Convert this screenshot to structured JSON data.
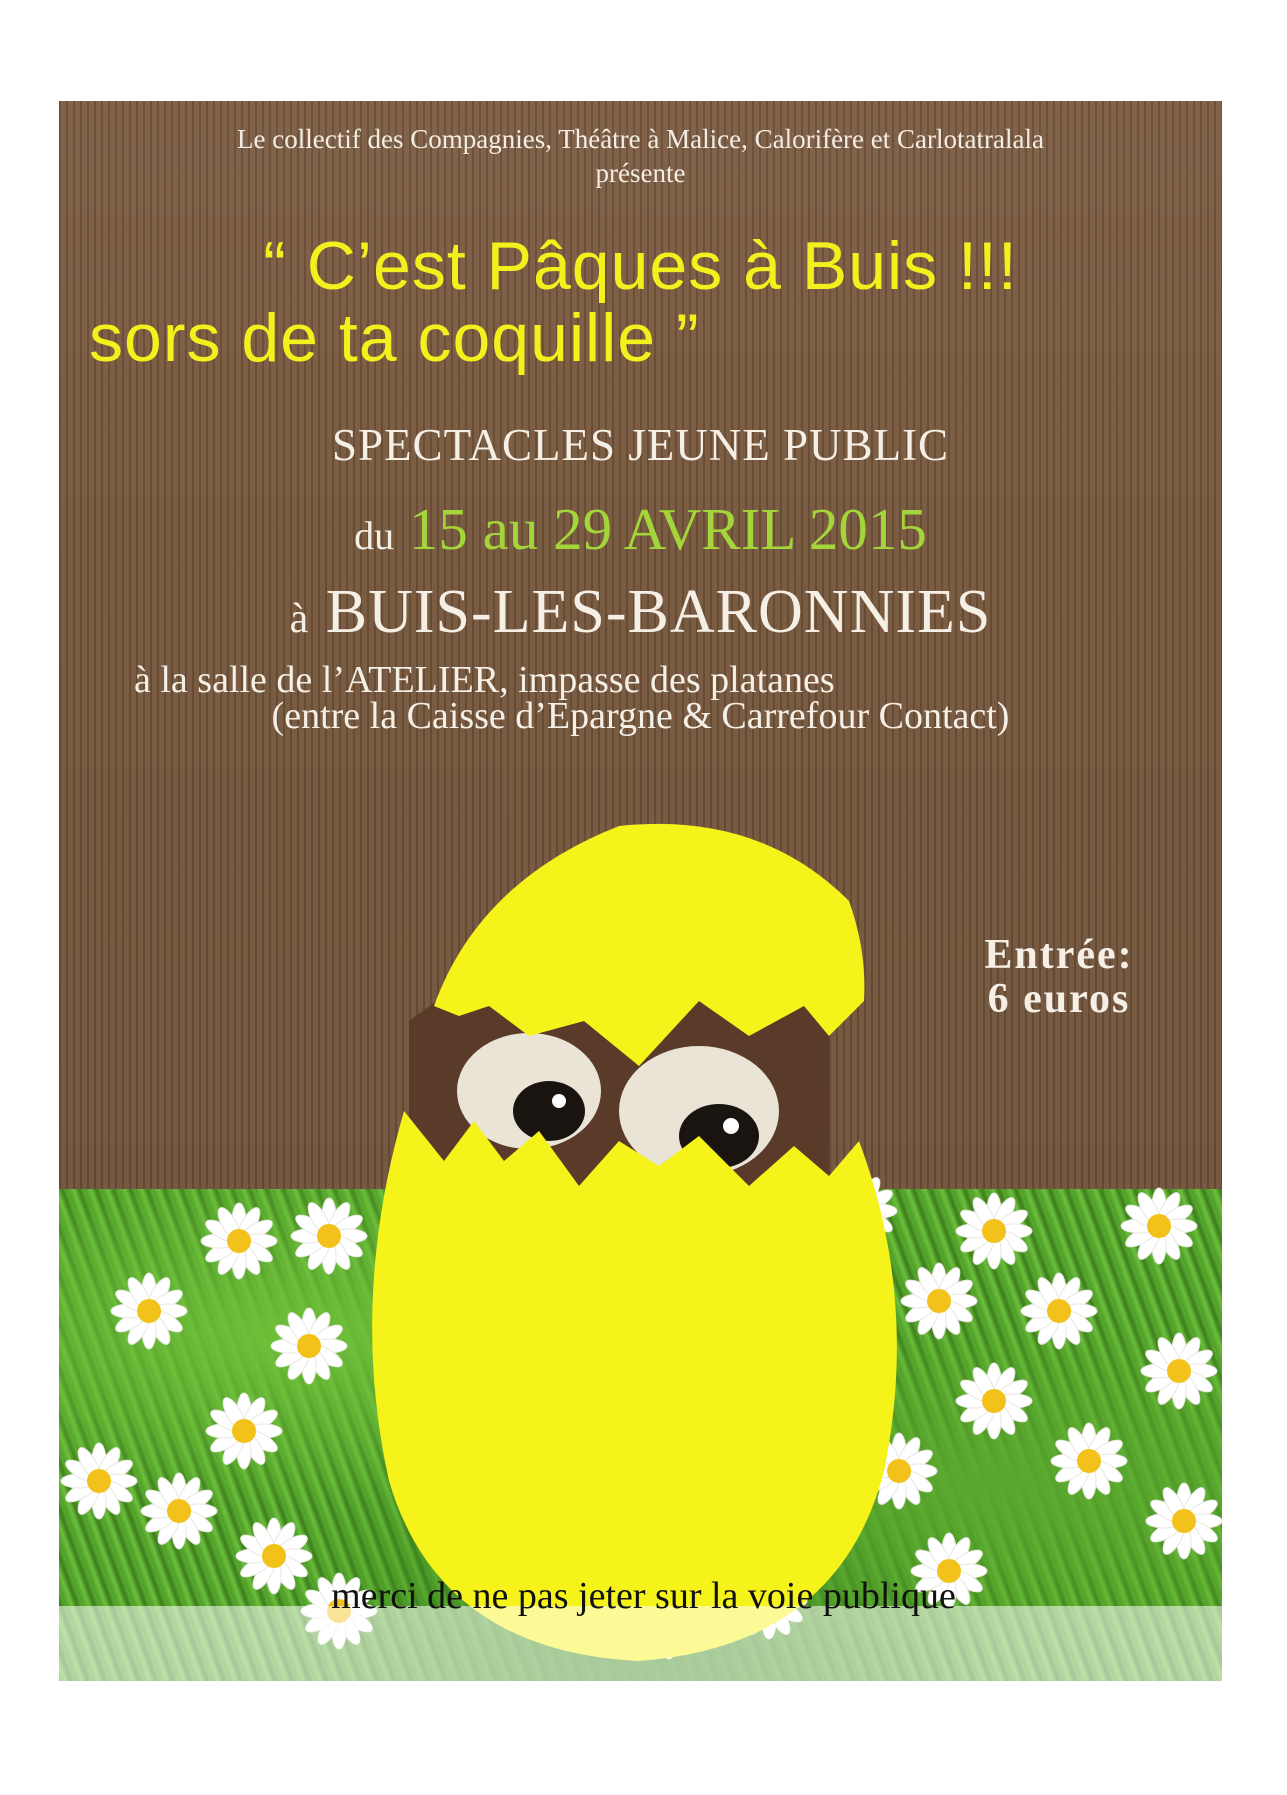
{
  "poster": {
    "presenter_line": "Le collectif des Compagnies, Théâtre à Malice, Calorifère et Carlotatralala",
    "presente": "présente",
    "title_line1": "“ C’est Pâques à Buis !!!",
    "title_line2": "sors de ta coquille ”",
    "subtitle": "SPECTACLES JEUNE PUBLIC",
    "dates_prefix": "du",
    "dates": "15 au 29 AVRIL 2015",
    "place_prefix": "à",
    "place": "BUIS-LES-BARONNIES",
    "venue_line1": "à la salle de l’ATELIER, impasse des platanes",
    "venue_line2": "(entre la Caisse d’Epargne & Carrefour Contact)",
    "entree_label": "Entrée:",
    "entree_price": "6 euros",
    "footer_note": "merci de ne pas jeter sur la voie publique"
  },
  "colors": {
    "kraft_brown": "#7a5a40",
    "title_yellow": "#f4f01e",
    "date_green": "#a4d63a",
    "egg_yellow": "#f5f31a",
    "text_cream": "#f5efe6"
  },
  "icons": {
    "illustration": "cracked-egg-with-eyes-icon",
    "decoration": "daisy-flower-icon"
  }
}
